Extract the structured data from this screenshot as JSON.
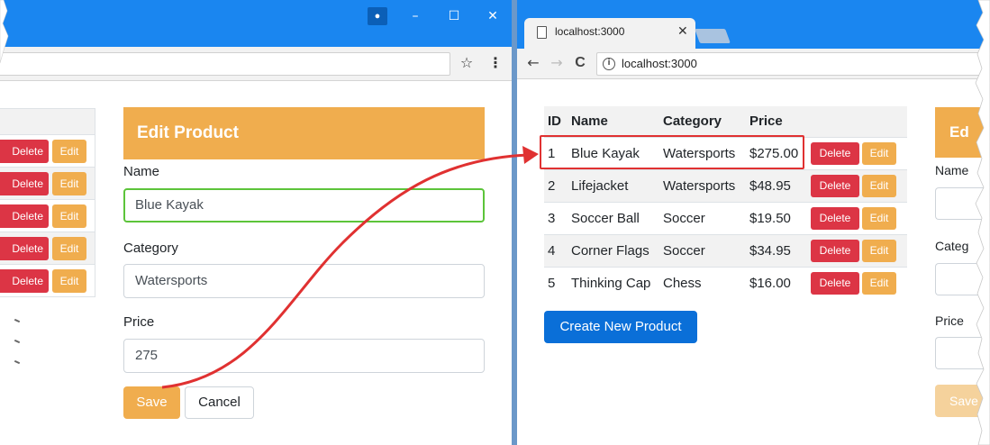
{
  "left_window": {
    "profile_icon": "person-icon",
    "window_controls": {
      "minimize": "–",
      "maximize": "☐",
      "close": "✕"
    },
    "toolbar": {
      "star_icon": "☆",
      "menu_icon": "⋮"
    },
    "mini_table": {
      "rows": [
        {
          "delete": "Delete",
          "edit": "Edit"
        },
        {
          "delete": "Delete",
          "edit": "Edit"
        },
        {
          "delete": "Delete",
          "edit": "Edit"
        },
        {
          "delete": "Delete",
          "edit": "Edit"
        },
        {
          "delete": "Delete",
          "edit": "Edit"
        }
      ]
    },
    "form": {
      "title": "Edit Product",
      "name_label": "Name",
      "name_value": "Blue Kayak",
      "category_label": "Category",
      "category_value": "Watersports",
      "price_label": "Price",
      "price_value": "275",
      "save_label": "Save",
      "cancel_label": "Cancel"
    }
  },
  "right_window": {
    "tab": {
      "title": "localhost:3000",
      "close": "✕"
    },
    "nav": {
      "back": "←",
      "forward": "→",
      "reload": "C",
      "info": "i"
    },
    "url": "localhost:3000",
    "table": {
      "headers": [
        "ID",
        "Name",
        "Category",
        "Price"
      ],
      "rows": [
        {
          "id": "1",
          "name": "Blue Kayak",
          "category": "Watersports",
          "price": "$275.00",
          "delete": "Delete",
          "edit": "Edit"
        },
        {
          "id": "2",
          "name": "Lifejacket",
          "category": "Watersports",
          "price": "$48.95",
          "delete": "Delete",
          "edit": "Edit"
        },
        {
          "id": "3",
          "name": "Soccer Ball",
          "category": "Soccer",
          "price": "$19.50",
          "delete": "Delete",
          "edit": "Edit"
        },
        {
          "id": "4",
          "name": "Corner Flags",
          "category": "Soccer",
          "price": "$34.95",
          "delete": "Delete",
          "edit": "Edit"
        },
        {
          "id": "5",
          "name": "Thinking Cap",
          "category": "Chess",
          "price": "$16.00",
          "delete": "Delete",
          "edit": "Edit"
        }
      ],
      "highlighted_row": 1
    },
    "create_button": "Create New Product",
    "clipped_form": {
      "title": "Ed",
      "name_label": "Name",
      "category_label": "Categ",
      "price_label": "Price",
      "save_label": "Save"
    }
  },
  "colors": {
    "title_bar": "#1a86f0",
    "warning": "#f0ad4e",
    "danger": "#dc3545",
    "primary": "#0a6fd8",
    "focus_border": "#5cc43a",
    "annotation_red": "#e03131"
  }
}
